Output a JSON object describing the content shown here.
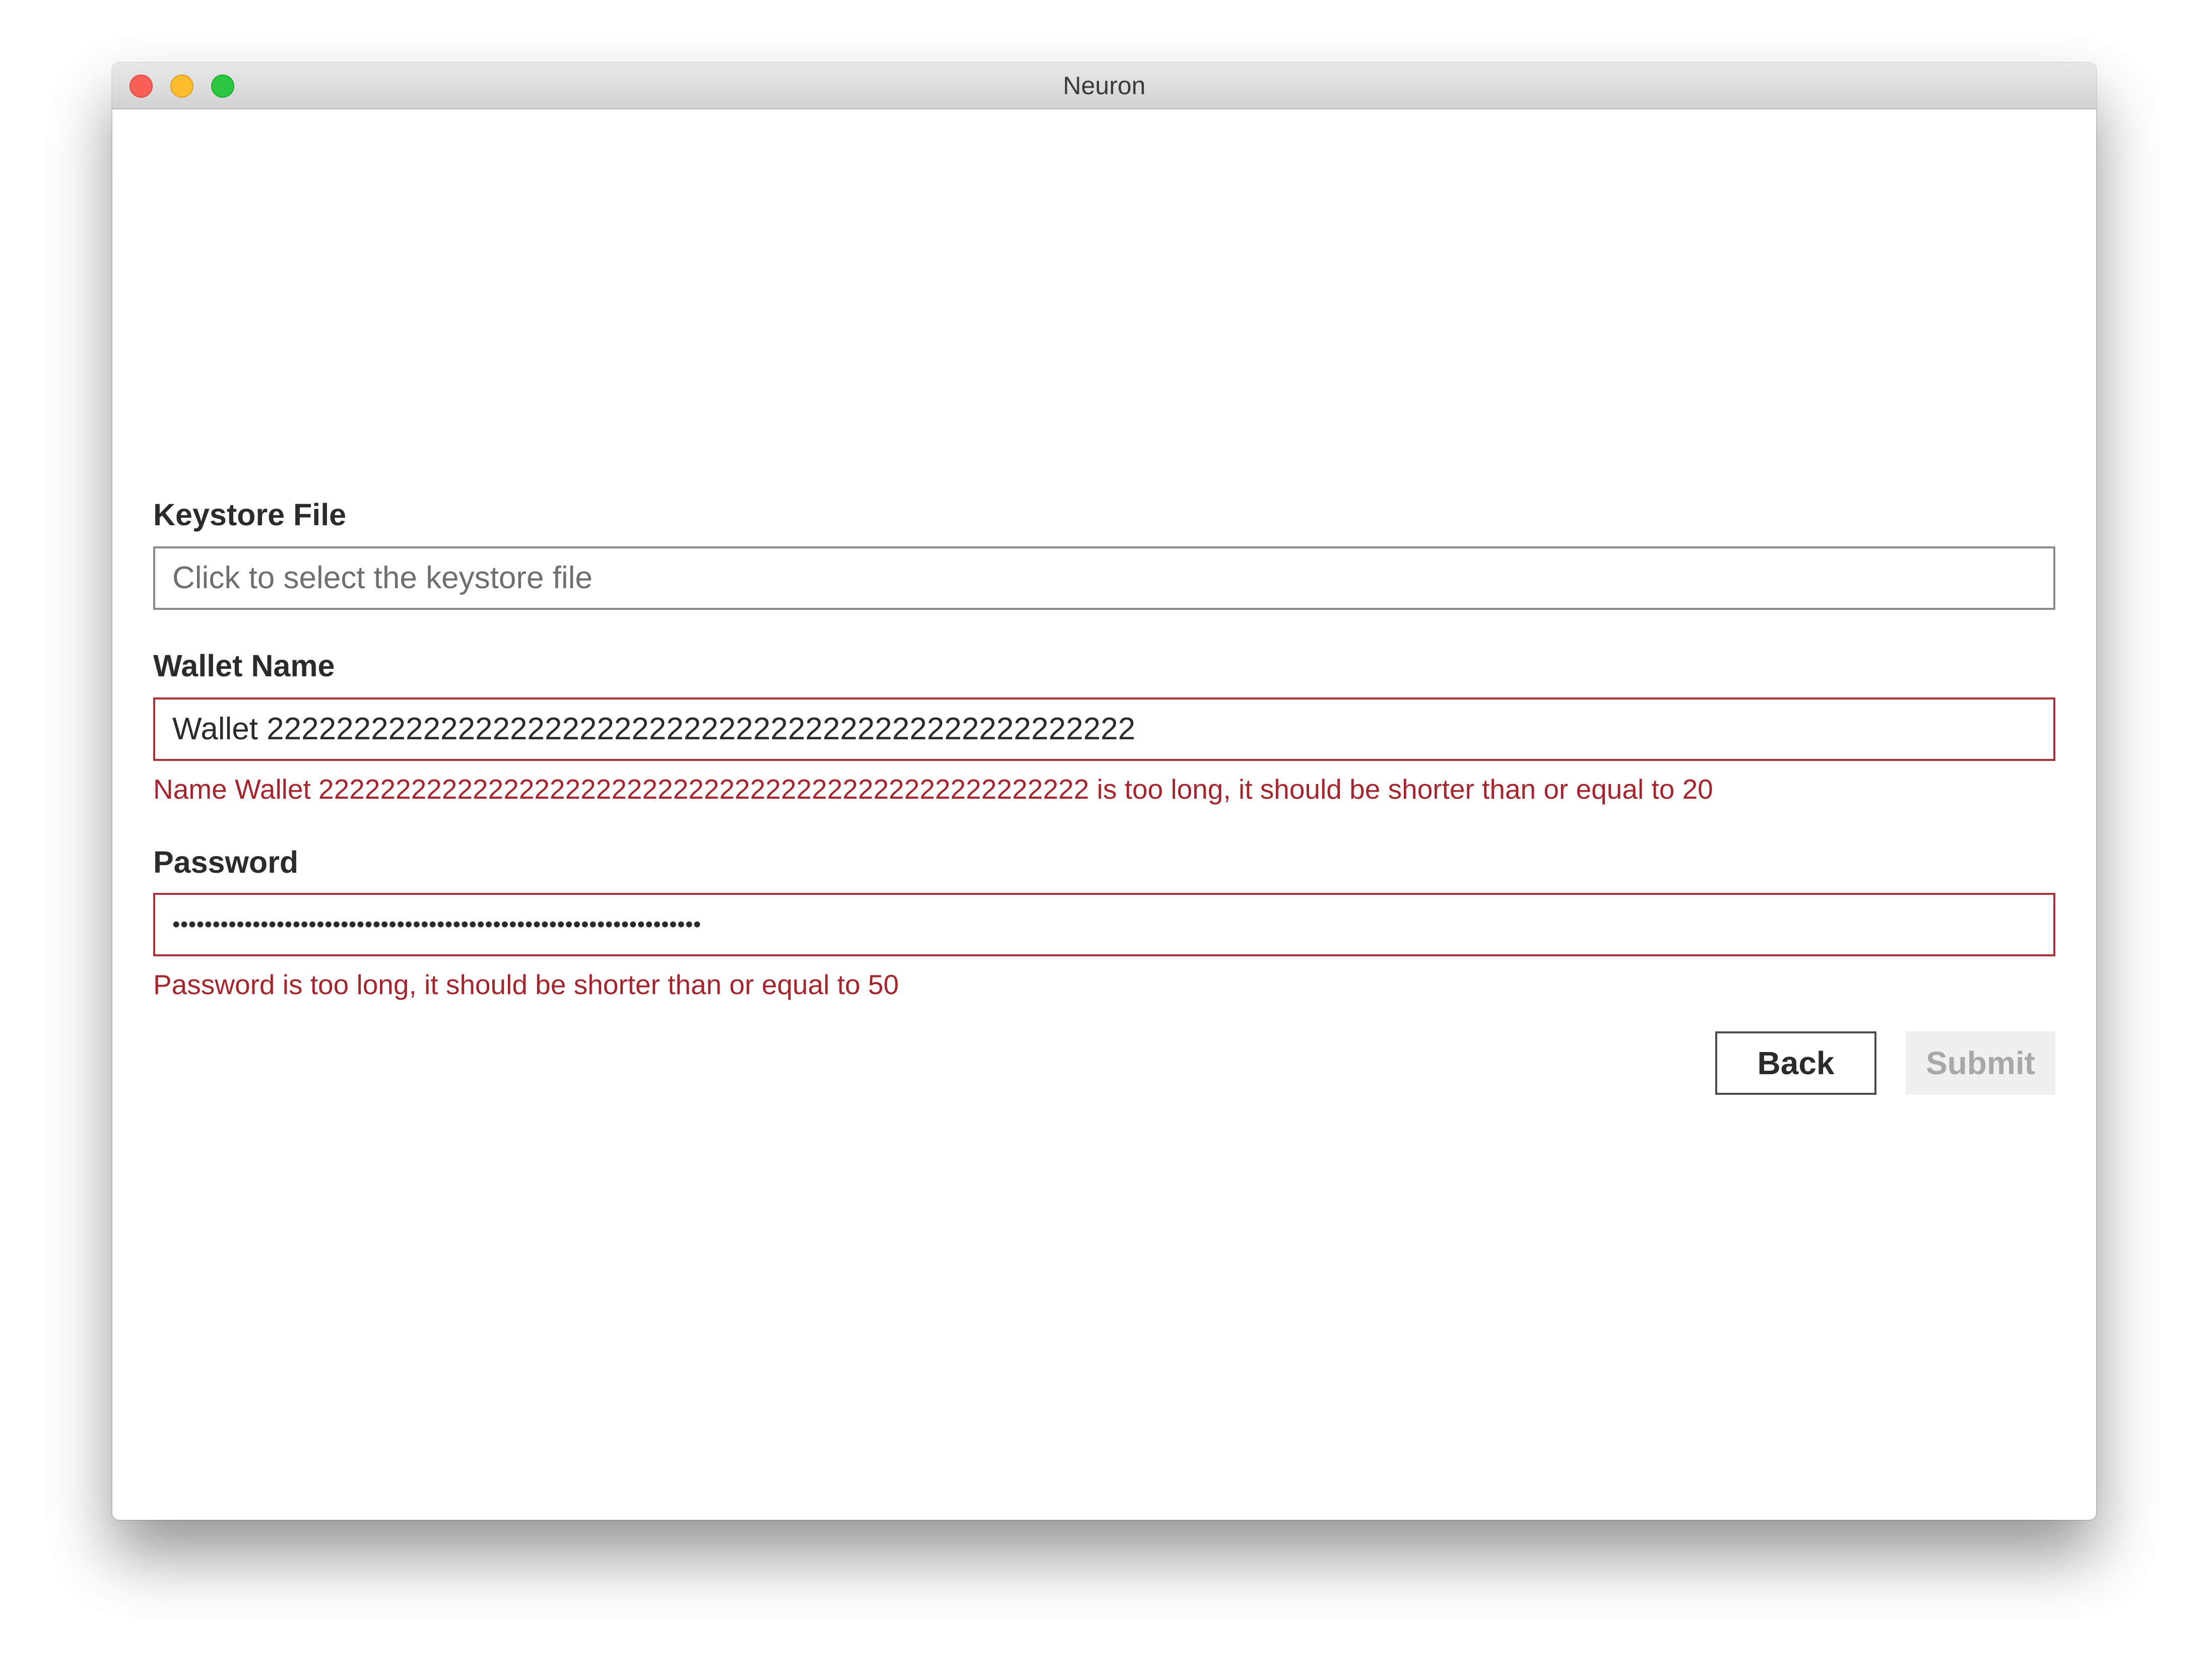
{
  "window": {
    "title": "Neuron"
  },
  "form": {
    "keystore": {
      "label": "Keystore File",
      "placeholder": "Click to select the keystore file"
    },
    "wallet_name": {
      "label": "Wallet Name",
      "value": "Wallet 22222222222222222222222222222222222222222222222222",
      "error": "Name Wallet 22222222222222222222222222222222222222222222222222 is too long, it should be shorter than or equal to 20"
    },
    "password": {
      "label": "Password",
      "value": "••••••••••••••••••••••••••••••••••••••••••••••••••••••••••••••••••",
      "error": "Password is too long, it should be shorter than or equal to 50"
    }
  },
  "buttons": {
    "back": "Back",
    "submit": "Submit"
  },
  "colors": {
    "error": "#a3262e",
    "error_border": "#a8323a",
    "disabled_text": "#a8a8a8"
  }
}
